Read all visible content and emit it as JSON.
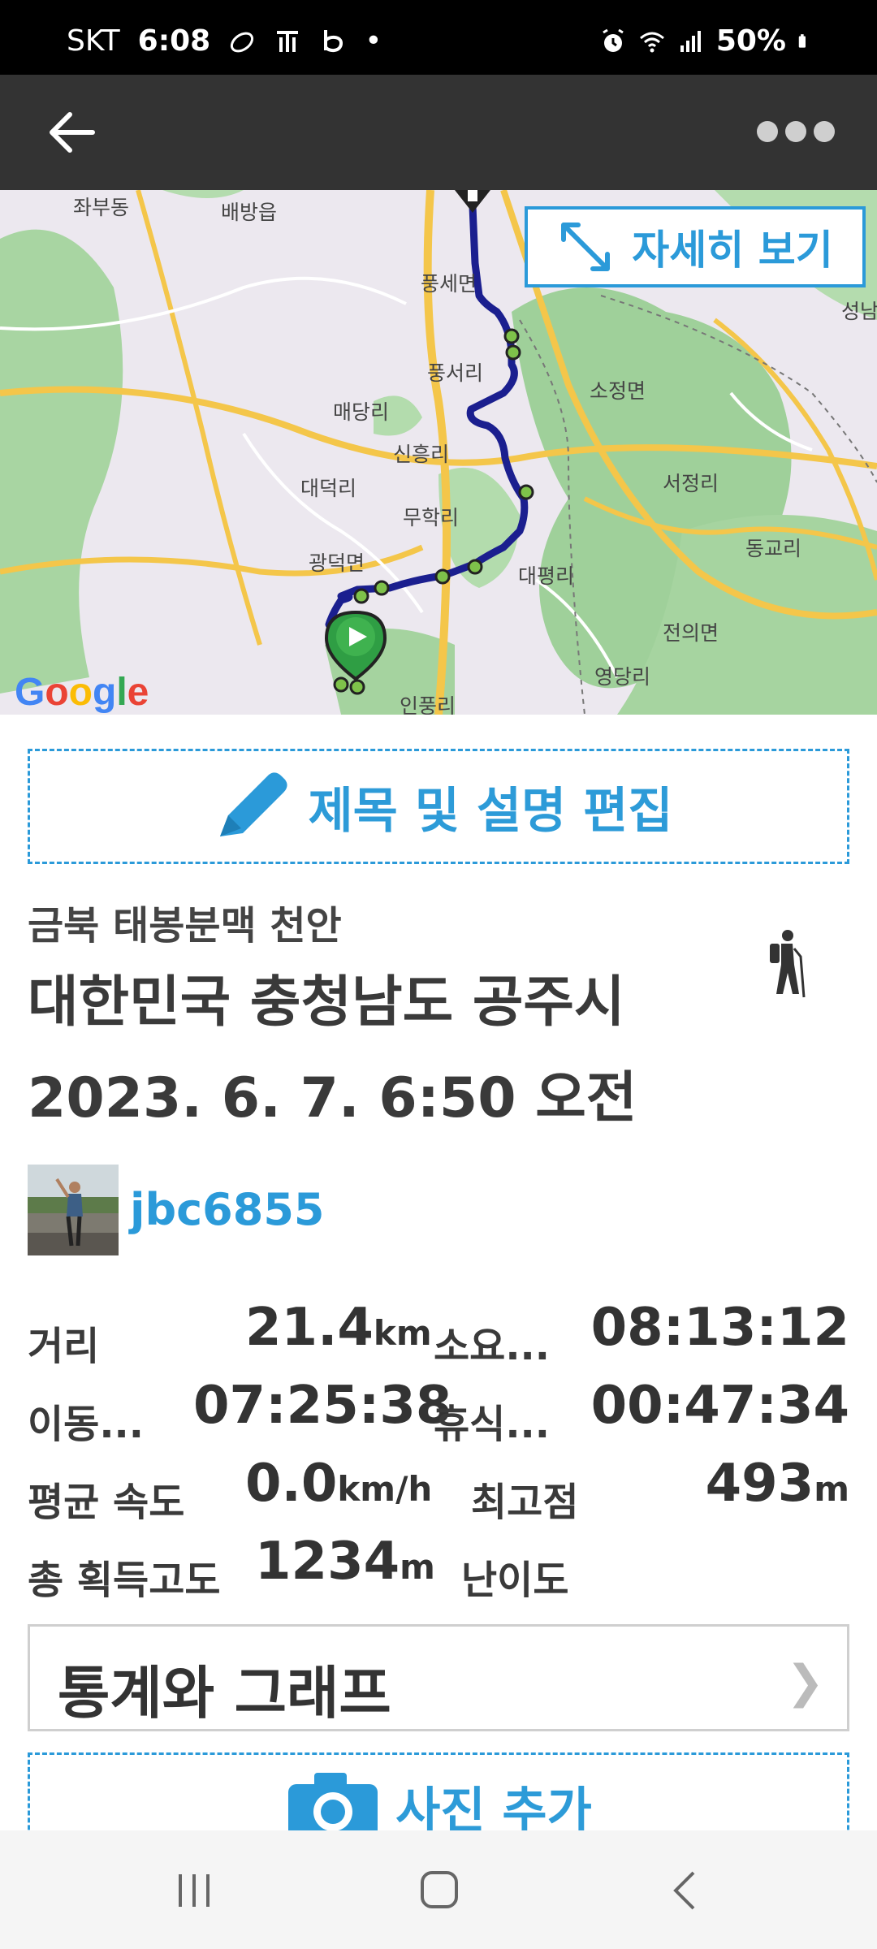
{
  "status_bar": {
    "carrier": "SKT",
    "time": "6:08",
    "dot": "•",
    "battery": "50%",
    "icons": [
      "run-icon",
      "t-icon",
      "b-icon",
      "alarm-icon",
      "wifi-icon",
      "signal-icon",
      "battery-icon"
    ]
  },
  "app_bar": {
    "back_icon": "back-arrow-icon",
    "more_icon": "more-dots-icon"
  },
  "map": {
    "detail_button": "자세히 보기",
    "labels": {
      "l1": "좌부동",
      "l2": "배방읍",
      "l3": "풍세면",
      "l4": "성남",
      "l5": "풍서리",
      "l6": "소정면",
      "l7": "매당리",
      "l8": "신흥리",
      "l9": "서정리",
      "l10": "대덕리",
      "l11": "무학리",
      "l12": "동교리",
      "l13": "광덕면",
      "l14": "대평리",
      "l15": "전의면",
      "l16": "영당리",
      "l17": "인풍리"
    },
    "google": "Google",
    "route_color": "#1b1f8f",
    "accent": "#2b9ad9"
  },
  "edit_button": "제목 및 설명 편집",
  "activity": {
    "subtitle": "금북 태봉분맥 천안",
    "location": "대한민국 충청남도 공주시",
    "datetime": "2023. 6. 7. 6:50 오전",
    "activity_icon": "hiker-icon"
  },
  "user": {
    "name": "jbc6855"
  },
  "stats": {
    "distance_label": "거리",
    "distance_value": "21.4",
    "distance_unit": "km",
    "duration_label": "소요...",
    "duration_value": "08:13:12",
    "moving_label": "이동...",
    "moving_value": "07:25:38",
    "rest_label": "휴식...",
    "rest_value": "00:47:34",
    "speed_label": "평균 속도",
    "speed_value": "0.0",
    "speed_unit": "km/h",
    "max_alt_label": "최고점",
    "max_alt_value": "493",
    "max_alt_unit": "m",
    "gain_label": "총 획득고도",
    "gain_value": "1234",
    "gain_unit": "m",
    "difficulty_label": "난이도"
  },
  "stats_button": {
    "label": "통계와 그래프",
    "chevron": "❯"
  },
  "photo_button": {
    "label": "사진 추가"
  }
}
